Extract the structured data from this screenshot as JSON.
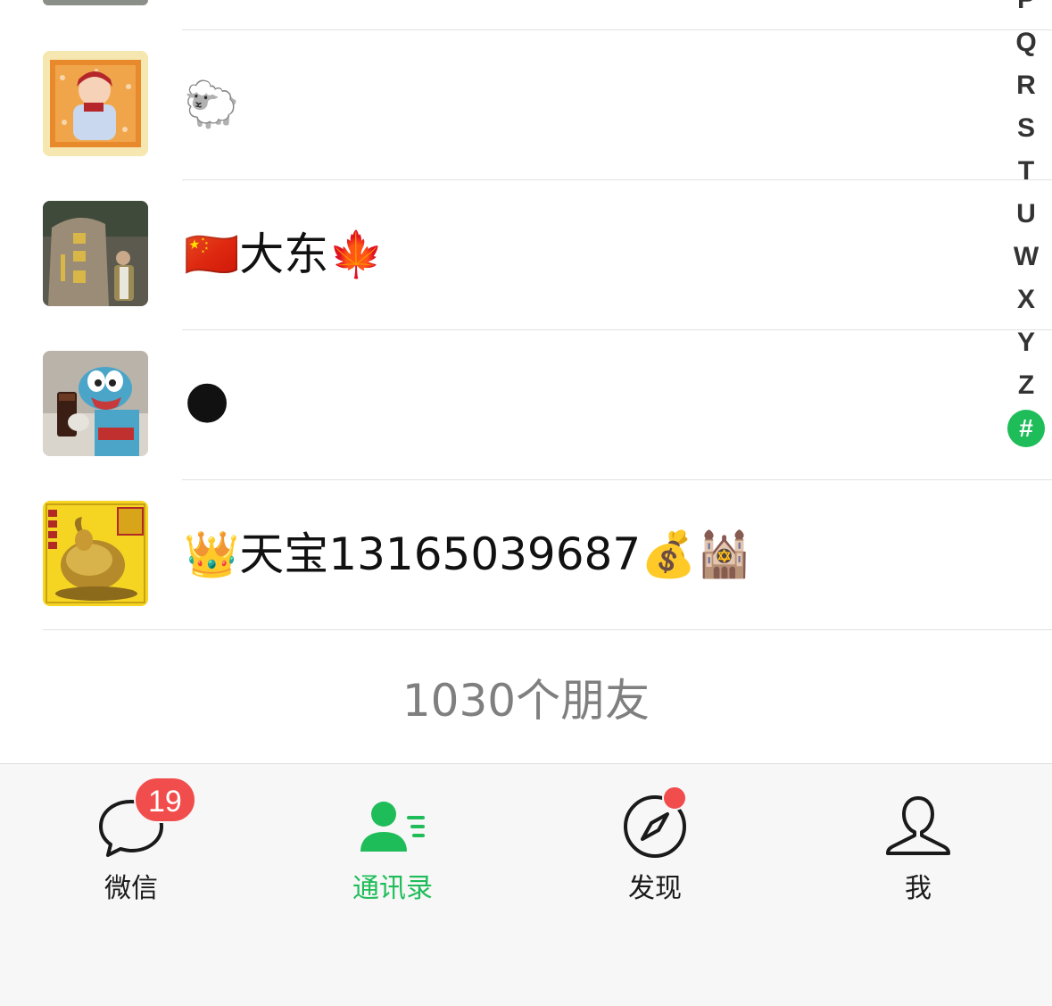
{
  "index_bar": {
    "letters": [
      "P",
      "Q",
      "R",
      "S",
      "T",
      "U",
      "W",
      "X",
      "Y",
      "Z",
      "#"
    ],
    "active": "#",
    "active_color": "#1fbd59"
  },
  "contacts": [
    {
      "name": "🐑",
      "avatar": "baby-photo-avatar"
    },
    {
      "name": "🇨🇳大东🍁",
      "avatar": "stone-monument-avatar"
    },
    {
      "name": "🌑",
      "avatar": "plush-toy-avatar"
    },
    {
      "name": "👑天宝13165039687💰🕍",
      "avatar": "golden-goat-avatar"
    }
  ],
  "friend_count": "1030个朋友",
  "tabs": [
    {
      "label": "微信",
      "icon": "chat-bubble-icon",
      "badge": "19"
    },
    {
      "label": "通讯录",
      "icon": "contacts-icon",
      "active": true
    },
    {
      "label": "发现",
      "icon": "compass-icon",
      "dot": true
    },
    {
      "label": "我",
      "icon": "person-icon"
    }
  ],
  "colors": {
    "accent": "#1fbd59",
    "badge": "#f14d4d",
    "tabbar_bg": "#f7f7f7"
  }
}
